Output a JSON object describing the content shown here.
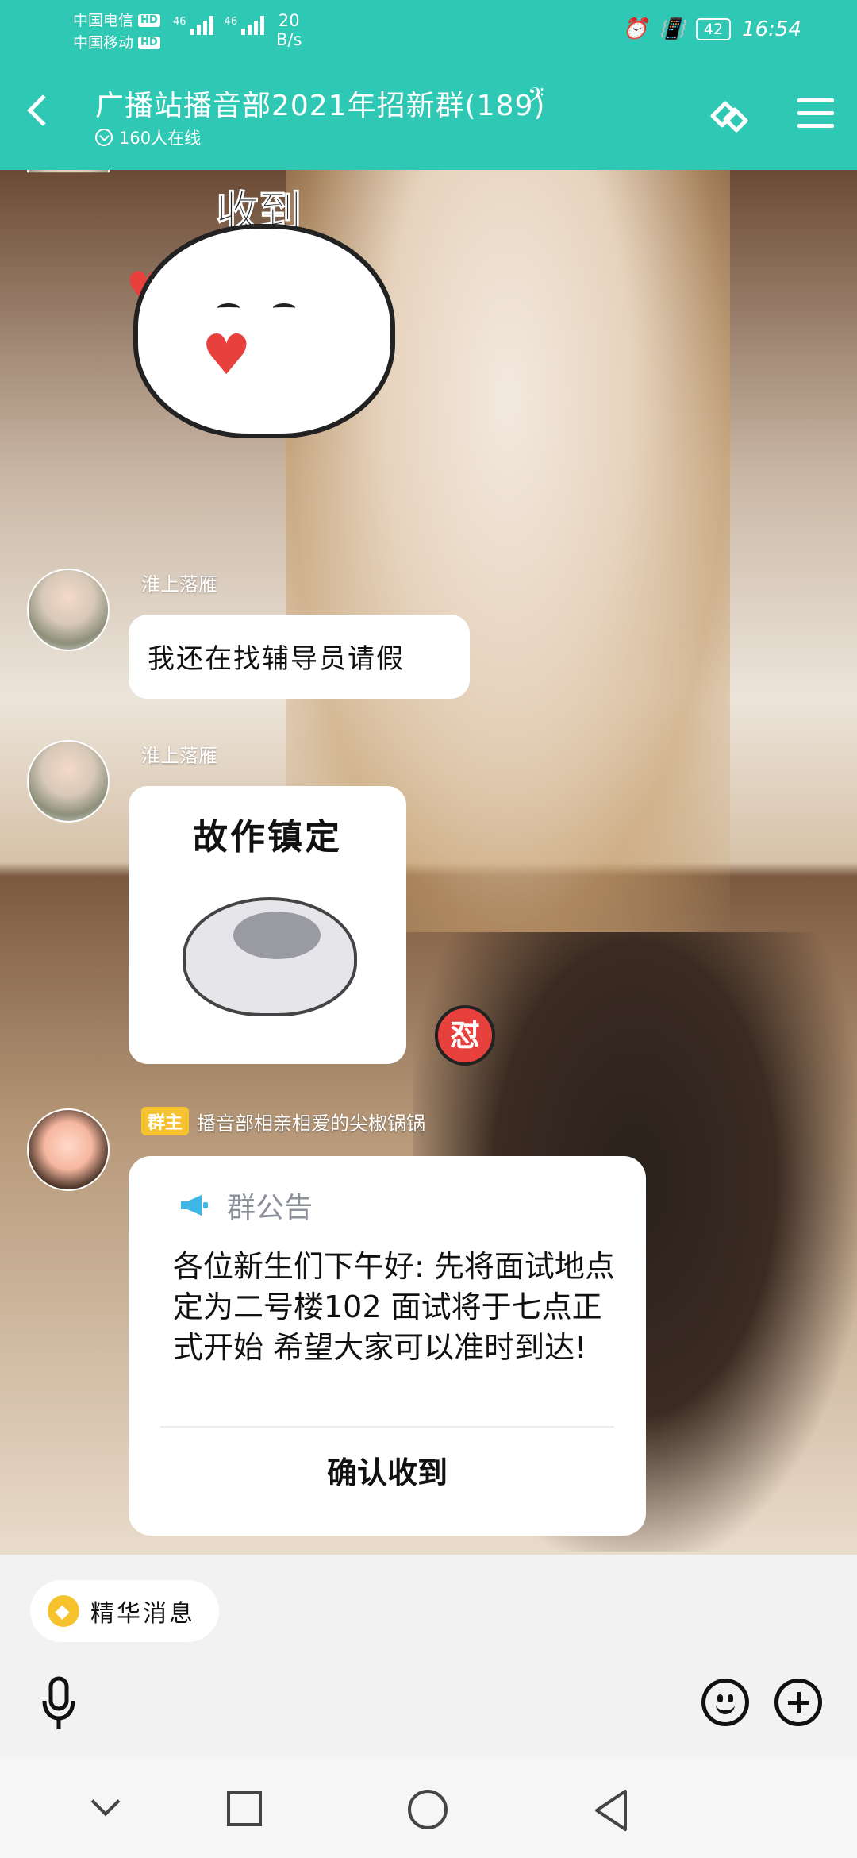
{
  "status_bar": {
    "carrier1": "中国电信",
    "carrier2": "中国移动",
    "hd": "HD",
    "net1": "46",
    "net2": "46",
    "speed_value": "20",
    "speed_unit": "B/s",
    "battery": "42",
    "time": "16:54"
  },
  "header": {
    "title": "广播站播音部2021年招新群(189)",
    "online": "160人在线"
  },
  "messages": [
    {
      "sender": "",
      "sticker_caption": "收到"
    },
    {
      "sender": "淮上落雁",
      "text": "我还在找辅导员请假"
    },
    {
      "sender": "淮上落雁",
      "sticker_caption": "故作镇定"
    }
  ],
  "background_badge": "怼",
  "announcement": {
    "role_badge": "群主",
    "sender": "播音部相亲相爱的尖椒锅锅",
    "title": "群公告",
    "body": "各位新生们下午好: 先将面试地点定为二号楼102 面试将于七点正式开始 希望大家可以准时到达!",
    "confirm": "确认收到"
  },
  "bottom": {
    "essence_label": "精华消息"
  },
  "colors": {
    "header": "#2ec8b4",
    "owner_badge": "#f6c22e",
    "notice_icon": "#3fb7e6"
  }
}
